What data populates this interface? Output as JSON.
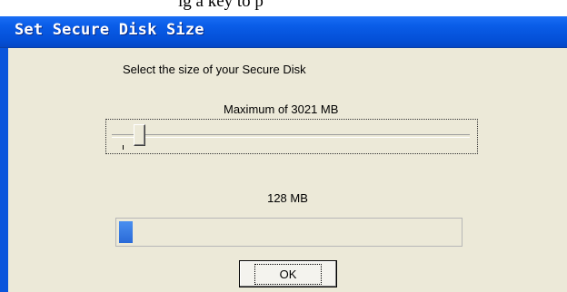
{
  "document_caption": "ig a key to p",
  "window": {
    "title": "Set Secure Disk Size"
  },
  "dialog": {
    "instruction": "Select the size of your Secure Disk",
    "maximum_label": "Maximum of 3021 MB",
    "slider": {
      "max_mb": 3021,
      "value_mb": 128
    },
    "size_label": "128 MB",
    "progress_fraction": 0.04,
    "ok_label": "OK"
  }
}
